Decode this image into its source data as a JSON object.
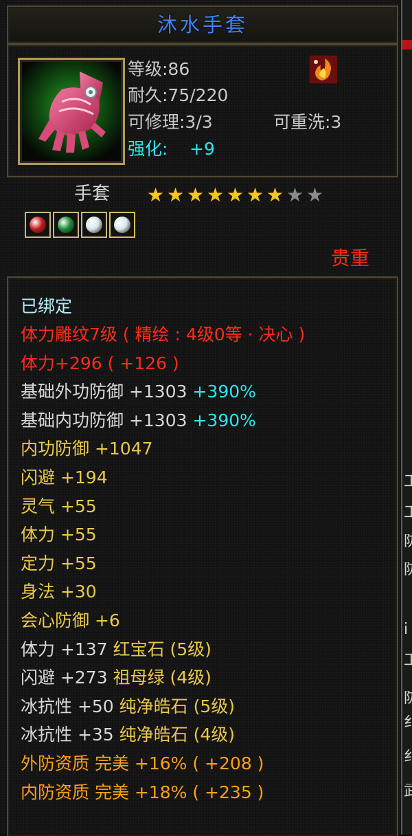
{
  "tooltip": {
    "title": "沐水手套",
    "info": {
      "level": "等级:86",
      "durability": "耐久:75/220",
      "repair": "可修理:3/3",
      "rewash": "可重洗:3",
      "enhance_label": "强化:",
      "enhance_value": "+9"
    },
    "type_label": "手套",
    "stars": {
      "filled": 7,
      "total": 9
    },
    "gems": [
      {
        "name": "ruby-gem-slot",
        "color": "#c81e1e"
      },
      {
        "name": "emerald-gem-slot",
        "color": "#1f8f3a"
      },
      {
        "name": "white-gem-slot-1",
        "color": "#d8e6ea"
      },
      {
        "name": "white-gem-slot-2",
        "color": "#d8e6ea"
      }
    ],
    "rarity": "贵重",
    "bound": "已绑定",
    "attributes": [
      {
        "parts": [
          {
            "text": "体力雕纹7级 ( 精绘 : 4级0等 · 决心 )",
            "color": "red"
          }
        ]
      },
      {
        "parts": [
          {
            "text": "体力+296 ( +126 )",
            "color": "red"
          }
        ]
      },
      {
        "parts": [
          {
            "text": "基础外功防御 +1303 ",
            "color": "white"
          },
          {
            "text": "+390%",
            "color": "cyan"
          }
        ]
      },
      {
        "parts": [
          {
            "text": "基础内功防御 +1303 ",
            "color": "white"
          },
          {
            "text": "+390%",
            "color": "cyan"
          }
        ]
      },
      {
        "parts": [
          {
            "text": "内功防御 +1047",
            "color": "yellow"
          }
        ]
      },
      {
        "parts": [
          {
            "text": "闪避 +194",
            "color": "yellow"
          }
        ]
      },
      {
        "parts": [
          {
            "text": "灵气 +55",
            "color": "yellow"
          }
        ]
      },
      {
        "parts": [
          {
            "text": "体力 +55",
            "color": "yellow"
          }
        ]
      },
      {
        "parts": [
          {
            "text": "定力 +55",
            "color": "yellow"
          }
        ]
      },
      {
        "parts": [
          {
            "text": "身法 +30",
            "color": "yellow"
          }
        ]
      },
      {
        "parts": [
          {
            "text": "会心防御 +6",
            "color": "yellow"
          }
        ]
      },
      {
        "parts": [
          {
            "text": "体力 +137 ",
            "color": "white"
          },
          {
            "text": "红宝石 (5级)",
            "color": "yellow"
          }
        ]
      },
      {
        "parts": [
          {
            "text": "闪避 +273 ",
            "color": "white"
          },
          {
            "text": "祖母绿 (4级)",
            "color": "yellow"
          }
        ]
      },
      {
        "parts": [
          {
            "text": "冰抗性 +50 ",
            "color": "white"
          },
          {
            "text": "纯净皓石 (5级)",
            "color": "yellow"
          }
        ]
      },
      {
        "parts": [
          {
            "text": "冰抗性 +35 ",
            "color": "white"
          },
          {
            "text": "纯净皓石 (4级)",
            "color": "yellow"
          }
        ]
      },
      {
        "parts": [
          {
            "text": "外防资质  完美 +16% ( +208 )",
            "color": "orange"
          }
        ]
      },
      {
        "parts": [
          {
            "text": "内防资质  完美 +18% ( +235 )",
            "color": "orange"
          }
        ]
      }
    ],
    "colors": {
      "red": "#ff2a1a",
      "white": "#d8d8d8",
      "yellow": "#e9c84a",
      "orange": "#ff9f1a",
      "cyan": "#2ee5ee",
      "title": "#3f82ff"
    }
  },
  "side_strip": {
    "fragments": [
      "工",
      "工",
      "防",
      "防",
      "i",
      "工",
      "防",
      "纟",
      "纟",
      "武"
    ]
  }
}
